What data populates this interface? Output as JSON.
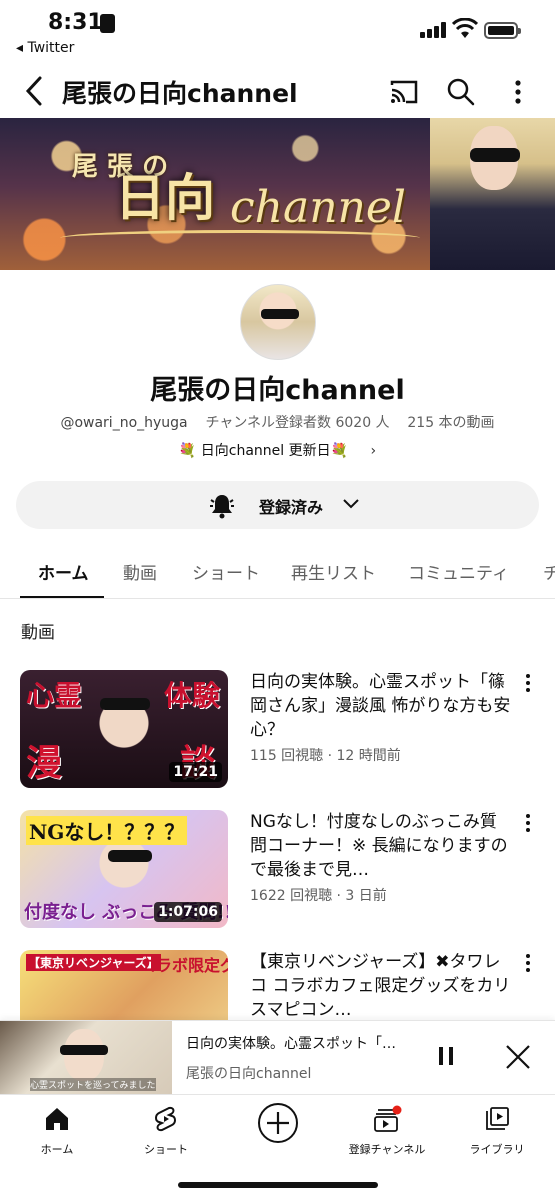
{
  "status_bar": {
    "time": "8:31",
    "back_app": "◂ Twitter"
  },
  "header": {
    "title": "尾張の日向channel"
  },
  "banner": {
    "kanji_small": "尾 張 の",
    "kanji_big": "日向",
    "script": "channel"
  },
  "channel": {
    "name": "尾張の日向channel",
    "handle": "@owari_no_hyuga",
    "subscribers": "チャンネル登録者数 6020 人",
    "video_count": "215 本の動画",
    "link_text": "💐 日向channel 更新日💐"
  },
  "subscribe": {
    "label": "登録済み"
  },
  "tabs": [
    "ホーム",
    "動画",
    "ショート",
    "再生リスト",
    "コミュニティ",
    "チ"
  ],
  "section": {
    "heading": "動画"
  },
  "videos": [
    {
      "title": "日向の実体験。心霊スポット「篠岡さん家」漫談風 怖がりな方も安心？",
      "meta": "115 回視聴 · 12 時間前",
      "duration": "17:21"
    },
    {
      "title": "NGなし！忖度なしのぶっこみ質問コーナー！※ 長編になりますので最後まで見…",
      "meta": "1622 回視聴 · 3 日前",
      "duration": "1:07:06"
    },
    {
      "title": "【東京リベンジャーズ】✖タワレコ コラボカフェ限定グッズをカリスマピコン…",
      "meta": "",
      "duration": ""
    }
  ],
  "thumb_text": {
    "v1": [
      "心霊",
      "体験",
      "漫",
      "談"
    ],
    "v2": [
      "NGなし！？？？",
      "付度なし ぶっこみ 質問!!"
    ],
    "v3": [
      "【東京リベンジャーズ】",
      "コラボ限定グッズ"
    ]
  },
  "mini_player": {
    "title": "日向の実体験。心霊スポット「…",
    "channel": "尾張の日向channel",
    "caption": "心霊スポットを巡ってみました"
  },
  "bottom_nav": [
    {
      "label": "ホーム",
      "icon": "home-icon"
    },
    {
      "label": "ショート",
      "icon": "shorts-icon"
    },
    {
      "label": "",
      "icon": "create-plus-icon"
    },
    {
      "label": "登録チャンネル",
      "icon": "subscriptions-icon"
    },
    {
      "label": "ライブラリ",
      "icon": "library-icon"
    }
  ],
  "colors": {
    "accent": "#0f0f0f",
    "notification_dot": "#e62117",
    "muted": "#606060"
  }
}
